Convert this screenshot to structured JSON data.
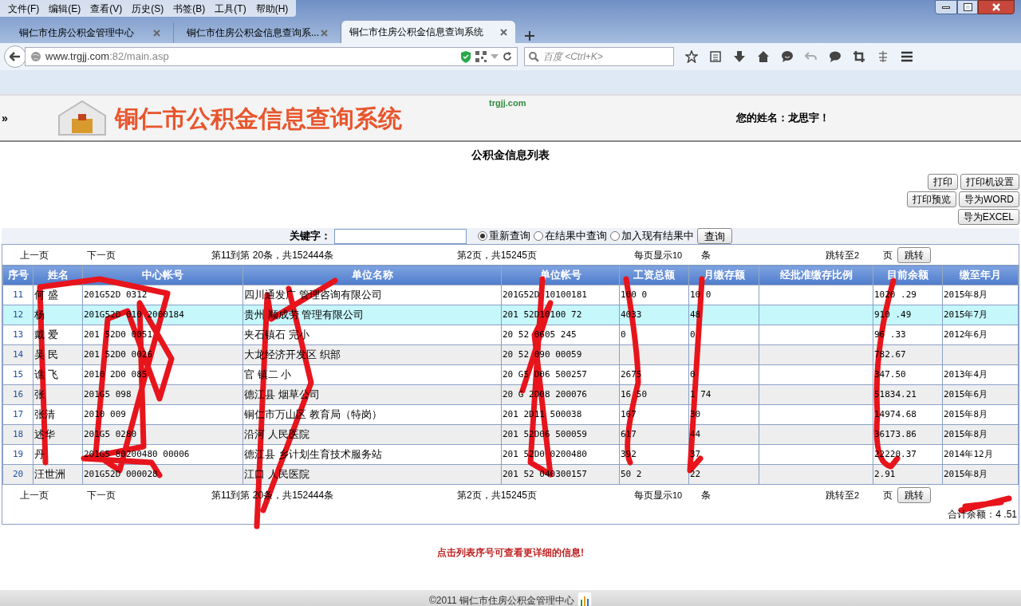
{
  "menu": [
    "文件(F)",
    "编辑(E)",
    "查看(V)",
    "历史(S)",
    "书签(B)",
    "工具(T)",
    "帮助(H)"
  ],
  "tabs": [
    {
      "label": "铜仁市住房公积金管理中心",
      "selected": false
    },
    {
      "label": "铜仁市住房公积金信息查询系...",
      "selected": false
    },
    {
      "label": "铜仁市住房公积金信息查询系统",
      "selected": true
    }
  ],
  "address": {
    "host": "www.trgjj.com",
    "rest": ":82/main.asp"
  },
  "search": {
    "placeholder": "百度 <Ctrl+K>"
  },
  "header": {
    "logo_text": "铜仁市公积金信息查询系统",
    "domain": "trgjj.com",
    "toggle": "»",
    "user": "您的姓名：龙思宇！"
  },
  "page_title": "公积金信息列表",
  "actions": [
    [
      "打印",
      "打印机设置"
    ],
    [
      "打印预览",
      "导为WORD"
    ],
    [
      "导为EXCEL"
    ]
  ],
  "query": {
    "label": "关键字：",
    "radios": [
      {
        "label": "重新查询",
        "selected": true
      },
      {
        "label": "在结果中查询",
        "selected": false
      },
      {
        "label": "加入现有结果中",
        "selected": false
      }
    ],
    "button": "查询"
  },
  "pager_top": {
    "prev": "上一页",
    "next": "下一页",
    "range": "第11到第 20条，共152444条",
    "pages": "第2页，共15245页",
    "per_page": "每页显示",
    "per_page_value": "10",
    "per_page_unit": "条",
    "goto": "跳转至",
    "goto_value": "2",
    "goto_unit": "页",
    "button": "跳转"
  },
  "pager_bottom": {
    "prev": "上一页",
    "next": "下一页",
    "range": "第11到第 20条，共152444条",
    "pages": "第2页，共15245页",
    "per_page": "每页显示",
    "per_page_value": "10",
    "per_page_unit": "条",
    "goto": "跳转至",
    "goto_value": "2",
    "goto_unit": "页",
    "button": "跳转"
  },
  "table": {
    "columns": [
      "序号",
      "姓名",
      "中心帐号",
      "单位名称",
      "单位帐号",
      "工资总额",
      "月缴存额",
      "经批准缴存比例",
      "目前余额",
      "缴至年月"
    ],
    "rows": [
      {
        "selected": false,
        "cells": [
          "11",
          "何 盛",
          "201G52D 0312",
          "四川通发广 管理咨询有限公司",
          "201G52D 10100181",
          "100 0",
          "10 0",
          "",
          "1020 .29",
          "2015年8月"
        ]
      },
      {
        "selected": true,
        "cells": [
          "12",
          "杨",
          "201G52D 010 2000184",
          "贵州 顺成劳 管理有限公司",
          "201 52D10100 72",
          "4033",
          "48",
          "",
          "910 .49",
          "2015年7月"
        ]
      },
      {
        "selected": false,
        "cells": [
          "13",
          "戴 爱",
          "201 52D0 0051",
          "夹石镇石 完小",
          "20 52 0605 245",
          "0",
          "0",
          "",
          "96 .33",
          "2012年6月"
        ]
      },
      {
        "selected": false,
        "cells": [
          "14",
          "吴 民",
          "201 52D0 0026",
          "大龙经济开发区 织部",
          "20 52 090 00059",
          "",
          "",
          "",
          "782.67",
          ""
        ]
      },
      {
        "selected": false,
        "cells": [
          "15",
          "谯 飞",
          "2010 2D0 085",
          "官 镇二 小",
          "20 G5 D06 500257",
          "2675",
          "0",
          "",
          "347.50",
          "2013年4月"
        ]
      },
      {
        "selected": false,
        "cells": [
          "16",
          "张",
          "201G5 098",
          "德江县 烟草公司",
          "20 G 2D08 200076",
          "16 50",
          "1 74",
          "",
          "51834.21",
          "2015年6月"
        ]
      },
      {
        "selected": false,
        "cells": [
          "17",
          "张清",
          "2010 009",
          "铜仁市万山区 教育局（特岗）",
          "201 2D11 500038",
          "167",
          "30",
          "",
          "14974.68",
          "2015年8月"
        ]
      },
      {
        "selected": false,
        "cells": [
          "18",
          "述华",
          "201G5 0280",
          "沿河 人民医院",
          "201 52D06 500059",
          "617",
          "44",
          "",
          "36173.86",
          "2015年8月"
        ]
      },
      {
        "selected": false,
        "cells": [
          "19",
          "丹",
          "201G5 80200480 00006",
          "德江县 乡计划生育技术服务站",
          "201 52D0 0200480",
          "392",
          "37",
          "",
          "22220.37",
          "2014年12月"
        ]
      },
      {
        "selected": false,
        "cells": [
          "20",
          "汪世洲",
          "201G52D 000028",
          "江口 人民医院",
          "201 52 040300157",
          "50 2",
          "22",
          "",
          "2.91",
          "2015年8月"
        ]
      }
    ]
  },
  "total": {
    "label": "合计余额：",
    "value": "4 .51"
  },
  "notice": "点击列表序号可查看更详细的信息!",
  "footer": "©2011 铜仁市住房公积金管理中心"
}
